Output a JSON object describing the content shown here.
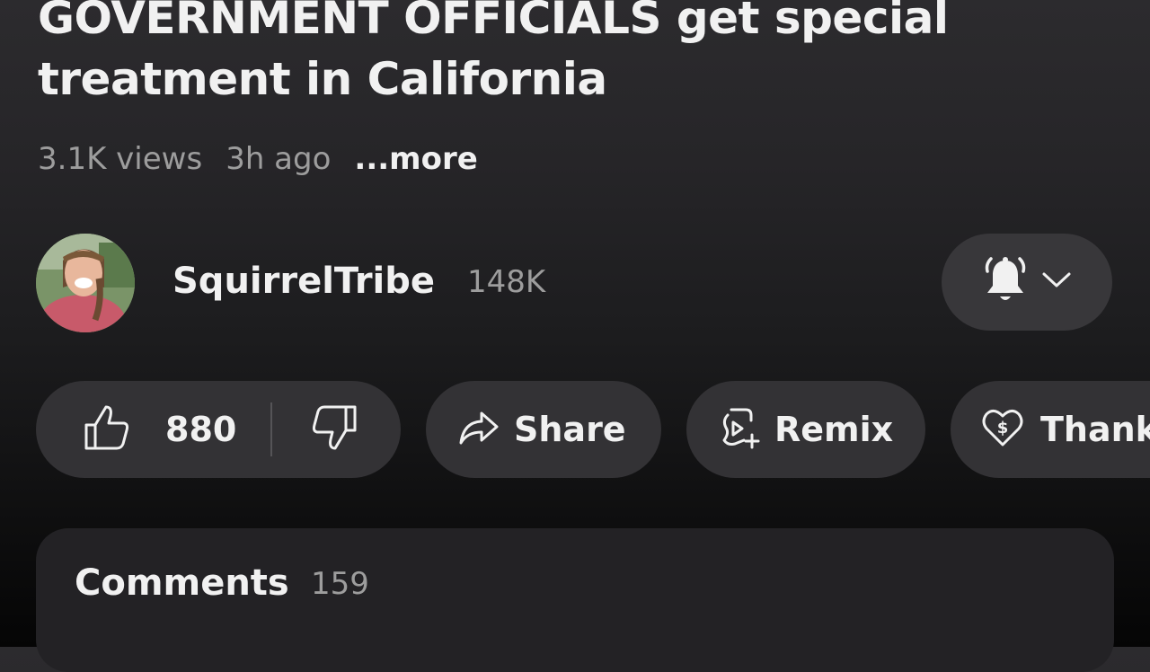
{
  "video": {
    "title_line1": "GOVERNMENT OFFICIALS get special",
    "title_line2": "treatment in California",
    "views": "3.1K views",
    "age": "3h ago",
    "more_label": "...more"
  },
  "channel": {
    "name": "SquirrelTribe",
    "subscribers": "148K",
    "notification_icon": "bell-filled-icon",
    "dropdown_icon": "chevron-down-icon"
  },
  "actions": {
    "like_count": "880",
    "share_label": "Share",
    "remix_label": "Remix",
    "thanks_label": "Thanks"
  },
  "comments": {
    "label": "Comments",
    "count": "159"
  },
  "colors": {
    "background_top": "#2c2b2e",
    "background_bottom": "#050505",
    "pill": "#333235",
    "text_primary": "#f1f1f1",
    "text_secondary": "#9d9d9d"
  }
}
